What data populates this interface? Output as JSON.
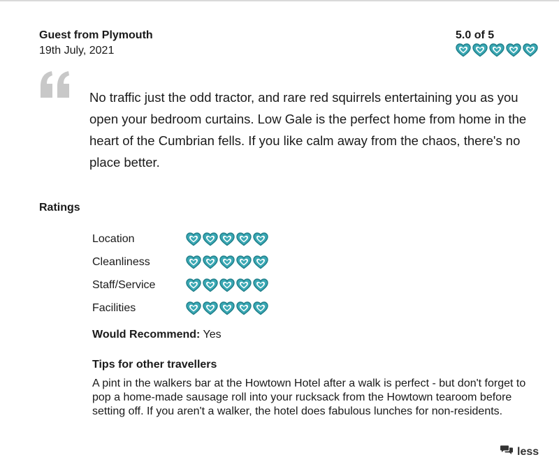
{
  "review": {
    "reviewer": "Guest from Plymouth",
    "date": "19th July, 2021",
    "score_text": "5.0 of 5",
    "overall_hearts": 5,
    "text": "No traffic just the odd tractor, and rare red squirrels entertaining you as you open your bedroom curtains. Low Gale is the perfect home from home in the heart of the Cumbrian fells. If you like calm away from the chaos, there's no place better."
  },
  "ratings": {
    "heading": "Ratings",
    "items": [
      {
        "label": "Location",
        "hearts": 5
      },
      {
        "label": "Cleanliness",
        "hearts": 5
      },
      {
        "label": "Staff/Service",
        "hearts": 5
      },
      {
        "label": "Facilities",
        "hearts": 5
      }
    ]
  },
  "recommend": {
    "label": "Would Recommend:",
    "value": "Yes"
  },
  "tips": {
    "heading": "Tips for other travellers",
    "text": "A pint in the walkers bar at the Howtown Hotel after a walk is perfect - but don't forget to pop a home-made sausage roll into your rucksack from the Howtown tearoom before setting off. If you aren't a walker, the hotel does fabulous lunches for non-residents."
  },
  "toggle": {
    "label": "less",
    "icon": "speech-bubbles-icon"
  },
  "colors": {
    "heart_fill": "#3aa8b4",
    "heart_stroke": "#1f7f8a",
    "quote_mark": "#c8c8c8"
  }
}
